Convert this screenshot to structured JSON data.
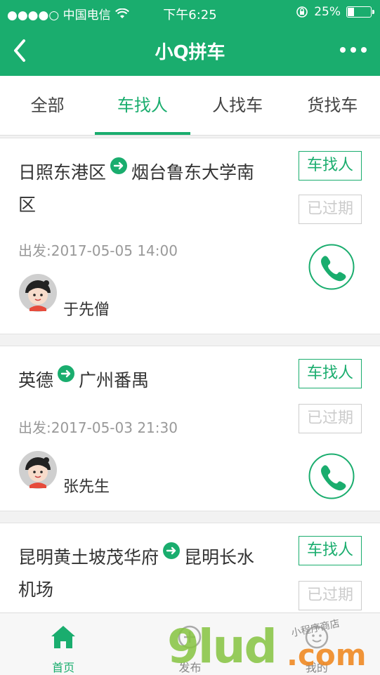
{
  "status_bar": {
    "carrier": "●●●●○ 中国电信",
    "time": "下午6:25",
    "battery": "25%",
    "battery_level": 0.25
  },
  "nav": {
    "title": "小Q拼车"
  },
  "tabs": [
    {
      "label": "全部",
      "active": false
    },
    {
      "label": "车找人",
      "active": true
    },
    {
      "label": "人找车",
      "active": false
    },
    {
      "label": "货找车",
      "active": false
    }
  ],
  "cards": [
    {
      "from": "日照东港区",
      "to_line1": "烟台鲁东大学南",
      "to_line2": "区",
      "depart": "出发:2017-05-05 14:00",
      "name": "于先僧",
      "type": "车找人",
      "status": "已过期"
    },
    {
      "from": "英德",
      "to_line1": "广州番禺",
      "to_line2": "",
      "depart": "出发:2017-05-03 21:30",
      "name": "张先生",
      "type": "车找人",
      "status": "已过期"
    },
    {
      "from": "昆明黄土坡茂华府",
      "to_line1": "昆明长水",
      "to_line2": "机场",
      "depart": "",
      "name": "",
      "type": "车找人",
      "status": "已过期"
    }
  ],
  "tabbar": [
    {
      "label": "首页",
      "icon": "home-icon",
      "active": true
    },
    {
      "label": "发布",
      "icon": "publish-icon",
      "active": false
    },
    {
      "label": "我的",
      "icon": "profile-icon",
      "active": false
    }
  ],
  "watermark": {
    "brand": "9lud",
    "suffix": ".com",
    "tagline": "小程序商店"
  },
  "colors": {
    "brand": "#1aad6e",
    "expired": "#cccccc"
  }
}
